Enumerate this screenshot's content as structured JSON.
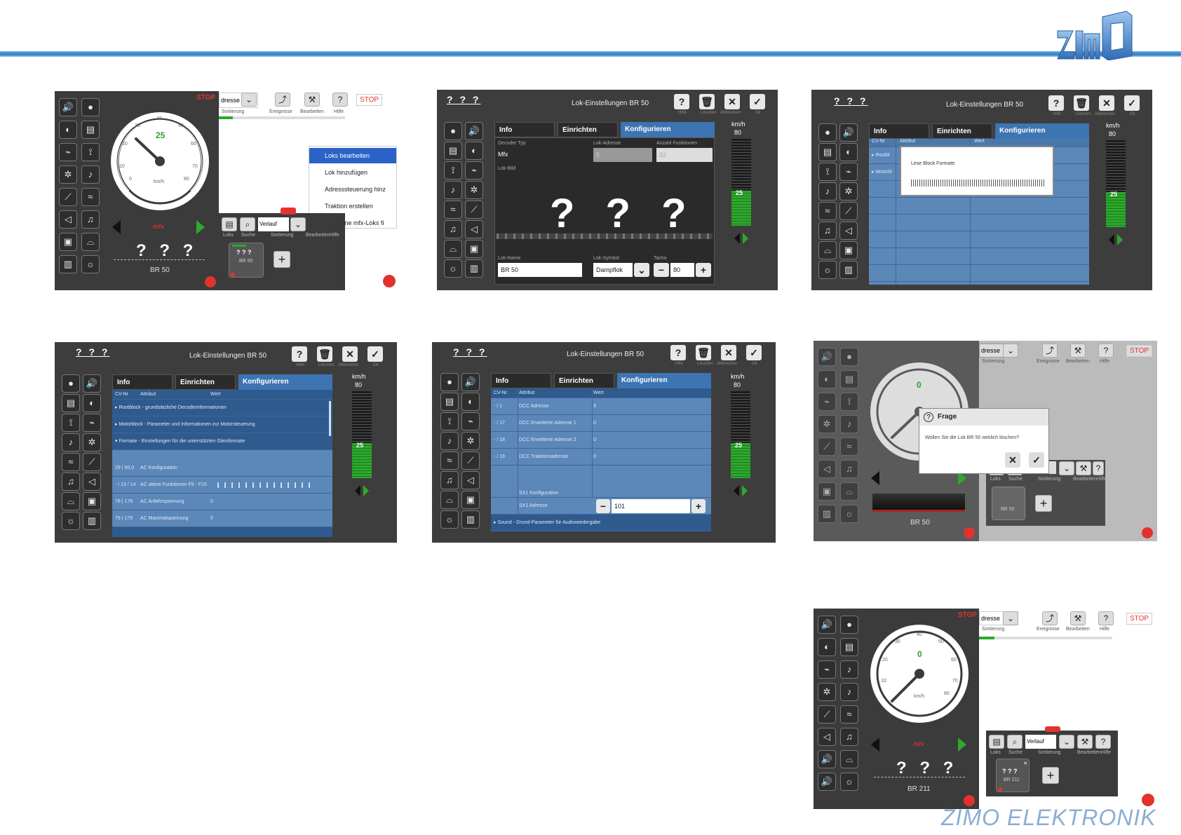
{
  "brand": {
    "logo_text": "zimo",
    "footer": "ZIMO ELEKTRONIK",
    "accent": "#2a7ac4"
  },
  "cab": {
    "stop": "STOP",
    "speed_25": "25",
    "speed_0": "0",
    "unit": "km/h",
    "mfx": "mfx",
    "qmarks": "? ? ?",
    "loco_br50": "BR 50",
    "loco_br211": "BR 211",
    "dial_ticks": [
      "0",
      "10",
      "20",
      "30",
      "40",
      "50",
      "60",
      "70",
      "80"
    ]
  },
  "toolbar": {
    "adresse": "dresse",
    "sortierung": "Sortierung",
    "ereignisse": "Ereignisse",
    "bearbeiten": "Bearbeiten",
    "hilfe": "Hilfe",
    "stop": "STOP",
    "verlauf": "Verlauf",
    "loks": "Loks",
    "suche": "Suche",
    "bearbeiten_hilfe": "BearbeitenHilfe",
    "card_q": "? ? ?",
    "card_br50": "BR 50",
    "card_br211": "BR 211"
  },
  "menu": {
    "items": [
      "Loks bearbeiten",
      "Lok hinzufügen",
      "Adresssteuerung hinz",
      "Traktion erstellen",
      "Verlorene mfx-Loks fi"
    ]
  },
  "settings": {
    "title": "Lok-Einstellungen BR 50",
    "qmarks": "? ? ?",
    "hdr_labels": [
      "Hilfe",
      "Löschen",
      "Abbrechen",
      "Ok"
    ],
    "tabs": [
      "Info",
      "Einrichten",
      "Konfigurieren"
    ],
    "kmh": "km/h",
    "kmh_val": "80",
    "bar_val": "25",
    "info": {
      "decoder_typ_label": "Decoder Typ",
      "decoder_typ": "Mfx",
      "lok_adresse_label": "Lok-Adresse",
      "lok_adresse": "5",
      "anzahl_funktionen_label": "Anzahl Funktionen",
      "anzahl_funktionen": "32",
      "lok_bild_label": "Lok-Bild",
      "big_q": "? ? ?",
      "lok_name_label": "Lok-Name",
      "lok_name": "BR 50",
      "lok_symbol_label": "Lok-Symbol",
      "lok_symbol": "Dampflok",
      "tacho_label": "Tacho",
      "tacho": "80"
    },
    "cv_header": [
      "CV-Nr",
      "Attribut",
      "Wert"
    ],
    "reading": {
      "rows": [
        "Rootbl",
        "Motorbl"
      ],
      "dialog_text": "Lese Block Formate"
    },
    "formats": {
      "rows": [
        {
          "cv": "",
          "attr": "Rootblock - grundsätzliche Decoderinformationen",
          "val": ""
        },
        {
          "cv": "",
          "attr": "Motorblock - Parameter und Informationen zur Motorsteuerung",
          "val": ""
        },
        {
          "cv": "",
          "attr": "Formate - Einstellungen für die unterstützten Gleisformate",
          "val": ""
        },
        {
          "cv": "29 | 50.0",
          "attr": "AC Konfiguration",
          "val": ""
        },
        {
          "cv": "- / 13 / 14",
          "attr": "AC aktive Funktionen F9 - F15",
          "val": ""
        },
        {
          "cv": "78 | 178",
          "attr": "AC Anfahrspannung",
          "val": "0"
        },
        {
          "cv": "79 | 179",
          "attr": "AC Maximalspannung",
          "val": "0"
        }
      ]
    },
    "dcc": {
      "rows": [
        {
          "cv": "- / 1",
          "attr": "DCC Adresse",
          "val": "3"
        },
        {
          "cv": "- / 17",
          "attr": "DCC Erweiterte Adresse 1",
          "val": "0"
        },
        {
          "cv": "- / 18",
          "attr": "DCC Erweiterte Adresse 2",
          "val": "0"
        },
        {
          "cv": "- / 19",
          "attr": "DCC Traktionsadresse",
          "val": "0"
        },
        {
          "cv": "",
          "attr": "SX1 Konfiguration",
          "val": ""
        },
        {
          "cv": "",
          "attr": "SX1 Adresse",
          "val": "101"
        },
        {
          "cv": "",
          "attr": "Sound - Grund-Parameter für Audiowiedergabe",
          "val": ""
        }
      ]
    }
  },
  "question": {
    "title": "Frage",
    "text": "Wollen Sie die Lok BR 50 wirklich löschen?"
  }
}
